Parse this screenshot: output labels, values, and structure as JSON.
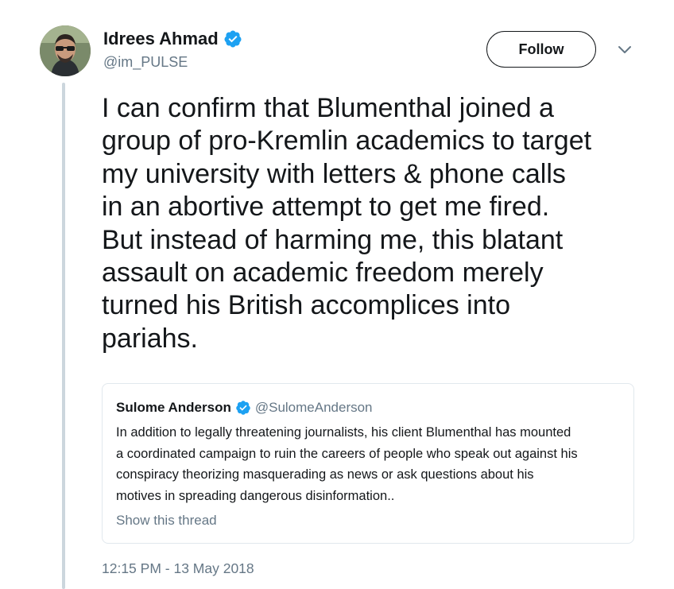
{
  "author": {
    "name": "Idrees Ahmad",
    "handle": "@im_PULSE",
    "verified": true
  },
  "follow_button": {
    "label": "Follow"
  },
  "menu": {
    "icon": "chevron-down-icon"
  },
  "tweet": {
    "text_lines": [
      "I can confirm that Blumenthal joined a",
      "group of pro-Kremlin academics to target",
      "my university with letters & phone calls",
      "in an abortive attempt to get me fired.",
      "But instead of harming me, this blatant",
      "assault on academic freedom merely",
      "turned his British accomplices into",
      "pariahs."
    ],
    "timestamp": "12:15 PM - 13 May 2018"
  },
  "quoted_tweet": {
    "name": "Sulome Anderson",
    "handle": "@SulomeAnderson",
    "verified": true,
    "text_lines": [
      "In addition to legally threatening journalists, his client Blumenthal has mounted",
      "a coordinated campaign to ruin the careers of people who speak out against his",
      "conspiracy theorizing masquerading as news or ask questions about his",
      "motives in spreading dangerous disinformation.."
    ],
    "show_thread_label": "Show this thread"
  },
  "colors": {
    "text_primary": "#14171a",
    "text_secondary": "#657786",
    "verified_blue": "#1da1f2",
    "border": "#e1e8ed",
    "thread_line": "#ccd6dd"
  }
}
